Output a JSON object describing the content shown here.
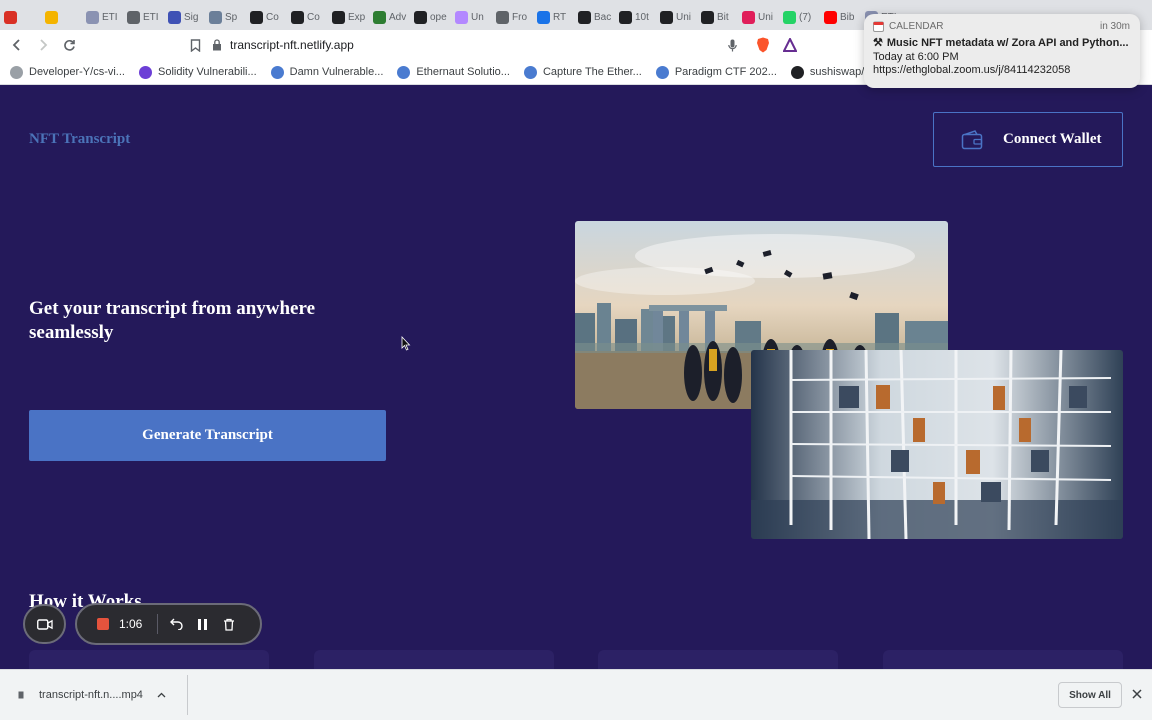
{
  "browser": {
    "tabs": [
      {
        "label": "",
        "icon": "gmail-icon",
        "color": "#d93025"
      },
      {
        "label": "",
        "icon": "drive-icon",
        "color": "#f4b400"
      },
      {
        "label": "ETI",
        "icon": "eth-icon",
        "color": "#8a92b2"
      },
      {
        "label": "ETI",
        "icon": "globe-icon",
        "color": "#5f6368"
      },
      {
        "label": "Sig",
        "icon": "u-icon",
        "color": "#3f51b5"
      },
      {
        "label": "Sp",
        "icon": "ship-icon",
        "color": "#6b7f99"
      },
      {
        "label": "Co",
        "icon": "notion-icon",
        "color": "#202124"
      },
      {
        "label": "Co",
        "icon": "notion-icon",
        "color": "#202124"
      },
      {
        "label": "Exp",
        "icon": "ex-icon",
        "color": "#202124"
      },
      {
        "label": "Adv",
        "icon": "n-icon",
        "color": "#2e7d32"
      },
      {
        "label": "ope",
        "icon": "github-icon",
        "color": "#202124"
      },
      {
        "label": "Un",
        "icon": "unicorn-icon",
        "color": "#b388ff"
      },
      {
        "label": "Fro",
        "icon": "globe-icon",
        "color": "#5f6368"
      },
      {
        "label": "RT",
        "icon": "rt-icon",
        "color": "#1a73e8"
      },
      {
        "label": "Bac",
        "icon": "paradigm-icon",
        "color": "#202124"
      },
      {
        "label": "10t",
        "icon": "paradigm-icon",
        "color": "#202124"
      },
      {
        "label": "Uni",
        "icon": "wolf-icon",
        "color": "#202124"
      },
      {
        "label": "Bit",
        "icon": "wolf-icon",
        "color": "#202124"
      },
      {
        "label": "Uni",
        "icon": "slack-icon",
        "color": "#e01e5a"
      },
      {
        "label": "(7)",
        "icon": "whatsapp-icon",
        "color": "#25d366"
      },
      {
        "label": "Bib",
        "icon": "youtube-icon",
        "color": "#ff0000"
      },
      {
        "label": "ETI",
        "icon": "eth-icon",
        "color": "#8a92b2"
      }
    ],
    "url": "transcript-nft.netlify.app",
    "bookmarks": [
      {
        "label": "Developer-Y/cs-vi...",
        "icon": "globe-icon"
      },
      {
        "label": "Solidity Vulnerabili...",
        "icon": "d-icon"
      },
      {
        "label": "Damn Vulnerable...",
        "icon": "dvd-icon"
      },
      {
        "label": "Ethernaut Solutio...",
        "icon": "dvd-icon"
      },
      {
        "label": "Capture The Ether...",
        "icon": "dvd-icon"
      },
      {
        "label": "Paradigm CTF 202...",
        "icon": "dvd-icon"
      },
      {
        "label": "sushiswap/Master...",
        "icon": "github-icon"
      }
    ]
  },
  "notification": {
    "app": "CALENDAR",
    "time": "in 30m",
    "title": "Music NFT metadata w/ Zora API and Python...",
    "when": "Today at 6:00 PM",
    "link": "https://ethglobal.zoom.us/j/84114232058"
  },
  "site": {
    "brand": "NFT Transcript",
    "connect_wallet": "Connect Wallet",
    "hero_title": "Get your transcript from anywhere seamlessly",
    "generate_button": "Generate Transcript",
    "how_it_works": "How it Works"
  },
  "recorder": {
    "elapsed": "1:06"
  },
  "downloads": {
    "file": "transcript-nft.n....mp4",
    "show_all": "Show All"
  },
  "colors": {
    "page_bg": "#24195a",
    "accent": "#4a73c5",
    "brand": "#4b73b8"
  }
}
